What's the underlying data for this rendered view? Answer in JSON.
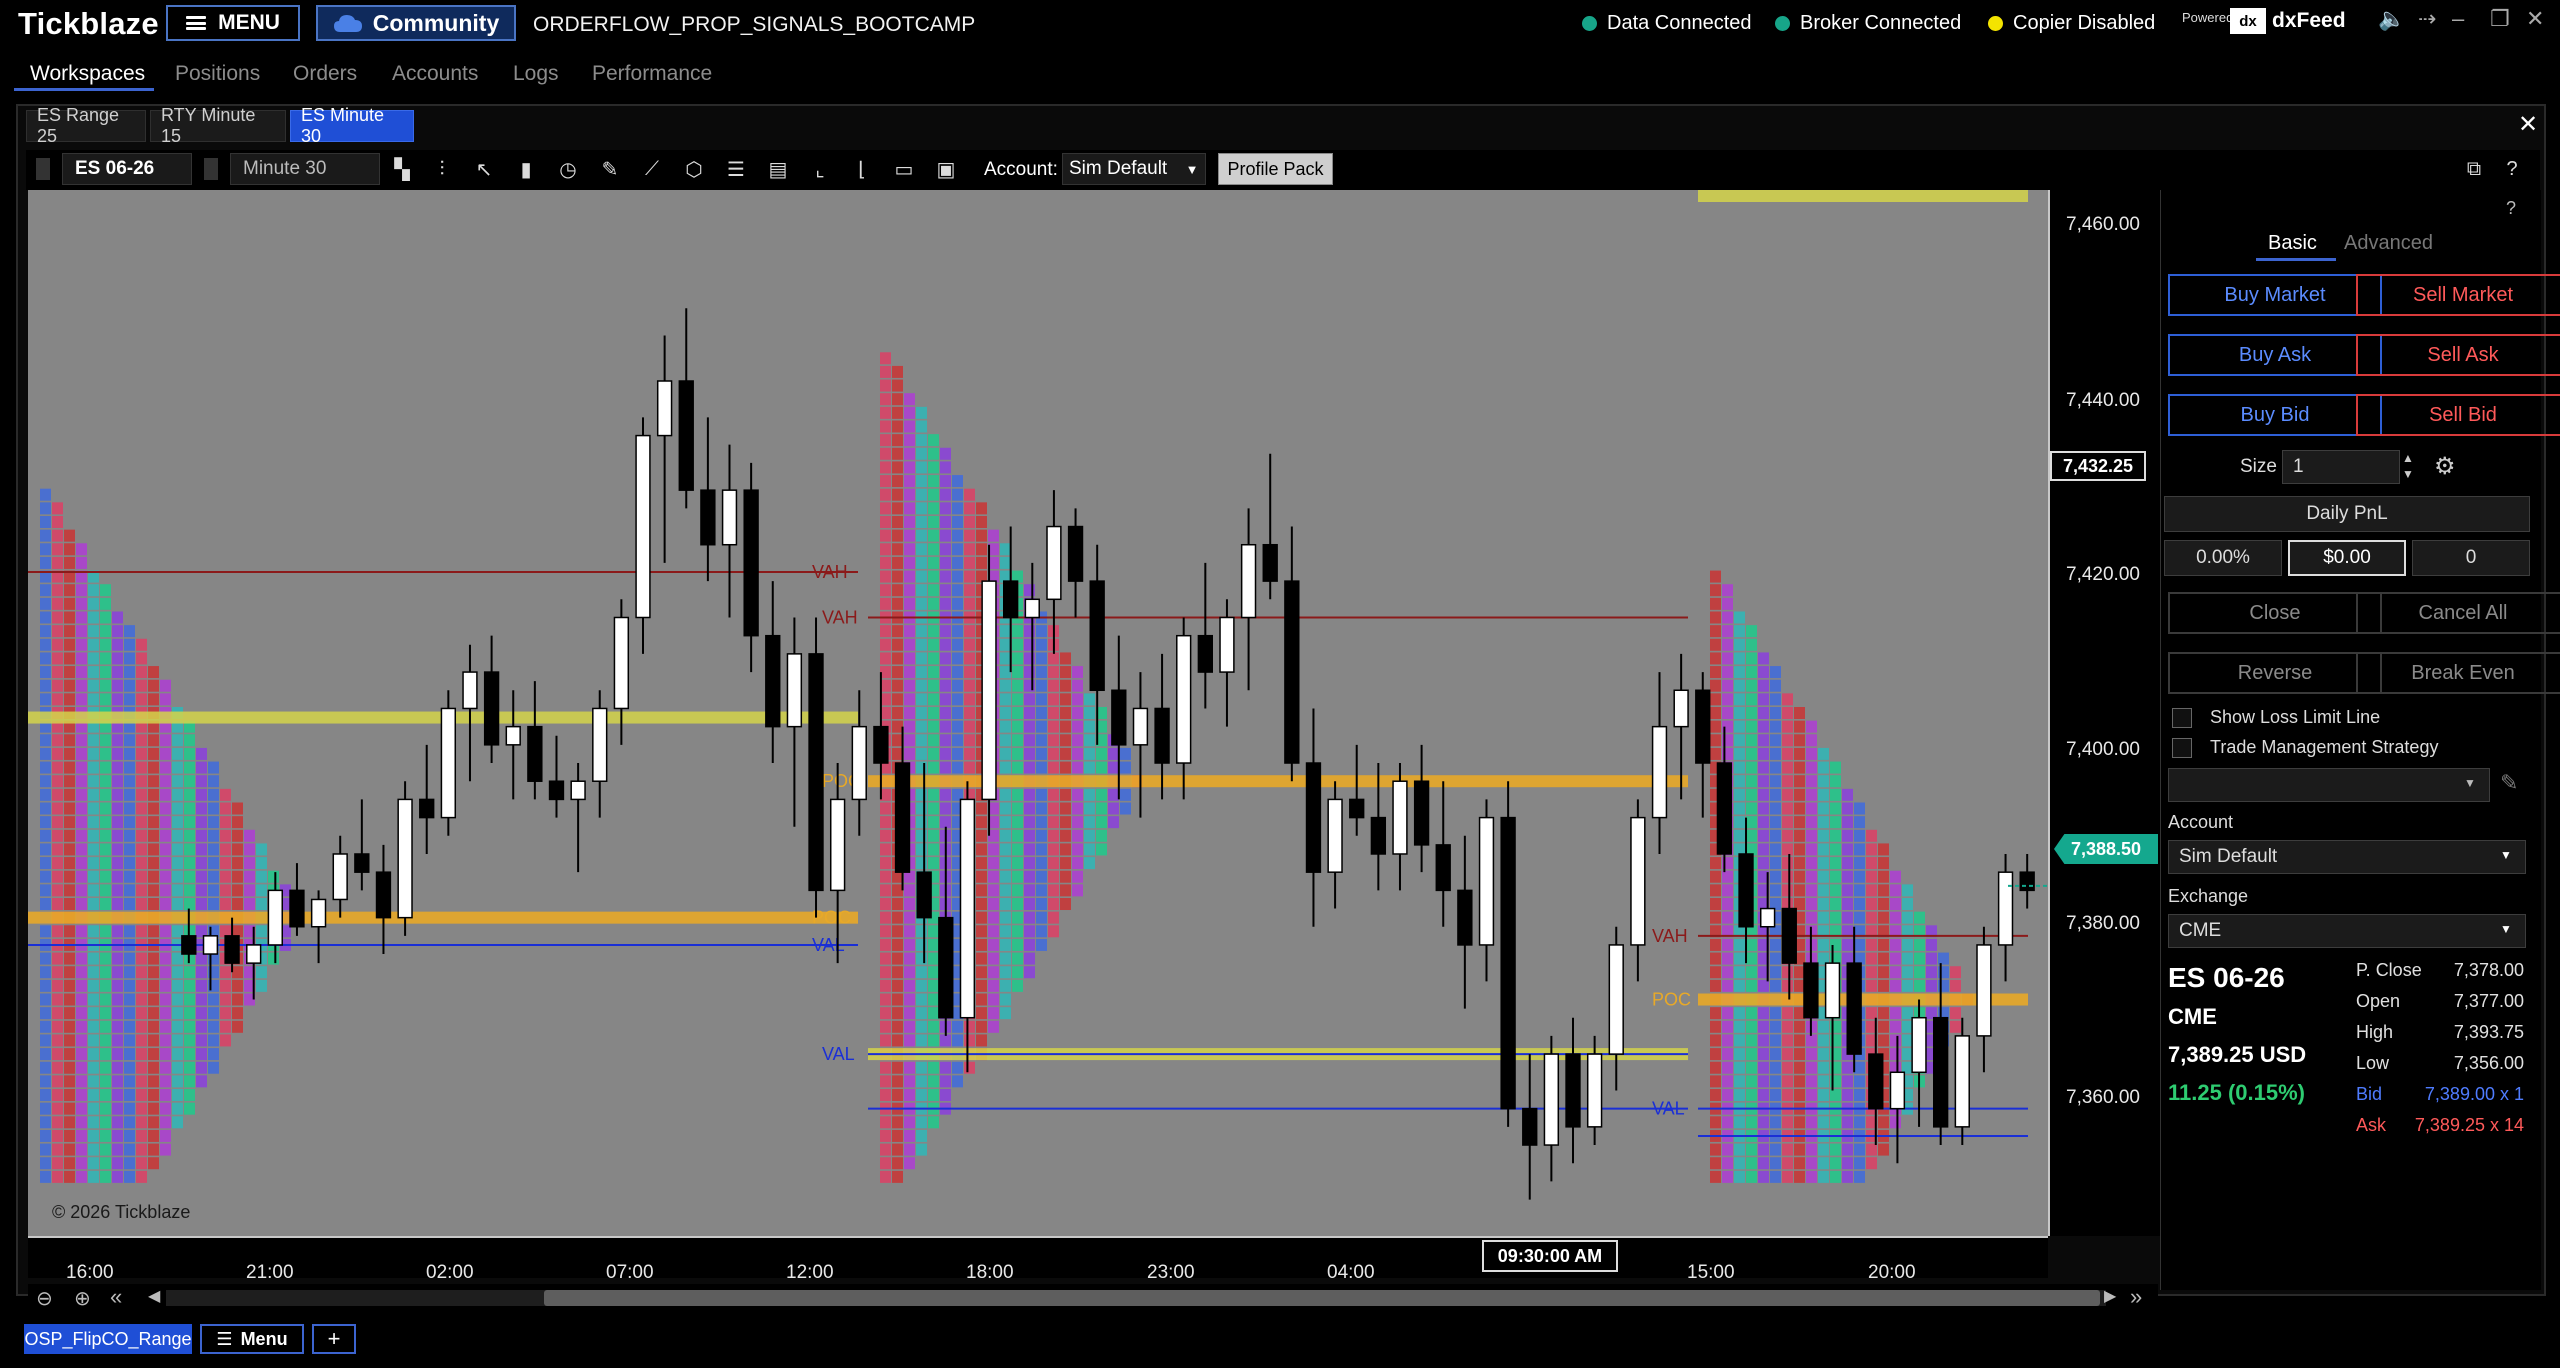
{
  "app": {
    "logo": "Tickblaze",
    "menu_label": "MENU",
    "community_label": "Community",
    "workspace_title": "ORDERFLOW_PROP_SIGNALS_BOOTCAMP",
    "status": [
      {
        "label": "Data Connected",
        "color": "#17a589"
      },
      {
        "label": "Broker Connected",
        "color": "#17a589"
      },
      {
        "label": "Copier Disabled",
        "color": "#f4e400"
      }
    ],
    "powered_by": "Powered by",
    "vendor": "dxFeed"
  },
  "nav": {
    "items": [
      "Workspaces",
      "Positions",
      "Orders",
      "Accounts",
      "Logs",
      "Performance"
    ],
    "active": "Workspaces"
  },
  "tabs": {
    "items": [
      "ES Range 25",
      "RTY Minute 15",
      "ES Minute 30"
    ],
    "active": "ES Minute 30"
  },
  "toolbar": {
    "symbol": "ES 06-26",
    "timeframe": "Minute 30",
    "account_label": "Account:",
    "account_value": "Sim Default",
    "profile_pack_label": "Profile Pack",
    "icons": [
      "bar-type-icon",
      "indicators-icon",
      "cursor-icon",
      "volume-bars-icon",
      "clock-icon",
      "pencil-icon",
      "line-draw-icon",
      "cube-icon",
      "list-icon",
      "template-icon",
      "axis-icon",
      "axis-alt-icon",
      "folder-icon",
      "save-icon"
    ]
  },
  "chart": {
    "copyright": "© 2026 Tickblaze",
    "crosshair_time": "09:30:00 AM",
    "crosshair_price": "7,432.25",
    "last_price": "7,388.50",
    "price_ticks": [
      "7,460.00",
      "7,440.00",
      "7,420.00",
      "7,400.00",
      "7,380.00",
      "7,360.00"
    ],
    "time_ticks": [
      "16:00",
      "21:00",
      "02:00",
      "07:00",
      "12:00",
      "18:00",
      "23:00",
      "04:00",
      "15:00",
      "20:00"
    ],
    "level_labels": {
      "vah": "VAH",
      "poc": "POC",
      "val": "VAL"
    },
    "colors": {
      "background": "#868686",
      "poc_bar": "#e8a928",
      "va_band": "#d4d44a",
      "vah_line": "#8b1a1a",
      "val_line": "#1a2fd6",
      "last_price": "#14a88e"
    }
  },
  "chart_data": {
    "type": "candlestick",
    "title": "",
    "symbol": "ES 06-26",
    "interval": "Minute 30",
    "ylim": [
      7350,
      7465
    ],
    "yticks": [
      7360,
      7380,
      7400,
      7420,
      7440,
      7460
    ],
    "xticks": [
      "16:00",
      "21:00",
      "02:00",
      "07:00",
      "12:00",
      "18:00",
      "23:00",
      "04:00",
      "15:00",
      "20:00"
    ],
    "grid": false,
    "last_price": 7388.5,
    "sessions": [
      {
        "vah": 7423,
        "poc": 7385,
        "val": 7382,
        "va_band": 7407
      },
      {
        "vah": 7418,
        "poc": 7400,
        "val": 7370,
        "val2": 7364,
        "va_band": 7370
      },
      {
        "vah": 7383,
        "poc": 7376,
        "val": 7364,
        "val2": 7361
      }
    ],
    "candles": [
      [
        7383,
        7386,
        7380,
        7381
      ],
      [
        7381,
        7384,
        7377,
        7383
      ],
      [
        7383,
        7385,
        7379,
        7380
      ],
      [
        7380,
        7384,
        7376,
        7382
      ],
      [
        7382,
        7390,
        7380,
        7388
      ],
      [
        7388,
        7391,
        7383,
        7384
      ],
      [
        7384,
        7388,
        7380,
        7387
      ],
      [
        7387,
        7394,
        7385,
        7392
      ],
      [
        7392,
        7398,
        7388,
        7390
      ],
      [
        7390,
        7393,
        7381,
        7385
      ],
      [
        7385,
        7400,
        7383,
        7398
      ],
      [
        7398,
        7404,
        7392,
        7396
      ],
      [
        7396,
        7410,
        7394,
        7408
      ],
      [
        7408,
        7415,
        7400,
        7412
      ],
      [
        7412,
        7416,
        7402,
        7404
      ],
      [
        7404,
        7410,
        7398,
        7406
      ],
      [
        7406,
        7411,
        7398,
        7400
      ],
      [
        7400,
        7405,
        7396,
        7398
      ],
      [
        7398,
        7402,
        7390,
        7400
      ],
      [
        7400,
        7410,
        7396,
        7408
      ],
      [
        7408,
        7420,
        7404,
        7418
      ],
      [
        7418,
        7440,
        7414,
        7438
      ],
      [
        7438,
        7449,
        7424,
        7444
      ],
      [
        7444,
        7452,
        7430,
        7432
      ],
      [
        7432,
        7440,
        7422,
        7426
      ],
      [
        7426,
        7437,
        7418,
        7432
      ],
      [
        7432,
        7435,
        7412,
        7416
      ],
      [
        7416,
        7422,
        7402,
        7406
      ],
      [
        7406,
        7418,
        7395,
        7414
      ],
      [
        7414,
        7418,
        7385,
        7388
      ],
      [
        7388,
        7402,
        7380,
        7398
      ],
      [
        7398,
        7410,
        7394,
        7406
      ],
      [
        7406,
        7412,
        7398,
        7402
      ],
      [
        7402,
        7406,
        7388,
        7390
      ],
      [
        7390,
        7402,
        7380,
        7385
      ],
      [
        7385,
        7395,
        7372,
        7374
      ],
      [
        7374,
        7400,
        7368,
        7398
      ],
      [
        7398,
        7426,
        7394,
        7422
      ],
      [
        7422,
        7428,
        7412,
        7418
      ],
      [
        7418,
        7424,
        7410,
        7420
      ],
      [
        7420,
        7432,
        7414,
        7428
      ],
      [
        7428,
        7430,
        7418,
        7422
      ],
      [
        7422,
        7426,
        7404,
        7410
      ],
      [
        7410,
        7416,
        7398,
        7404
      ],
      [
        7404,
        7412,
        7396,
        7408
      ],
      [
        7408,
        7414,
        7398,
        7402
      ],
      [
        7402,
        7418,
        7398,
        7416
      ],
      [
        7416,
        7424,
        7408,
        7412
      ],
      [
        7412,
        7420,
        7406,
        7418
      ],
      [
        7418,
        7430,
        7410,
        7426
      ],
      [
        7426,
        7436,
        7420,
        7422
      ],
      [
        7422,
        7428,
        7400,
        7402
      ],
      [
        7402,
        7408,
        7384,
        7390
      ],
      [
        7390,
        7400,
        7386,
        7398
      ],
      [
        7398,
        7404,
        7394,
        7396
      ],
      [
        7396,
        7402,
        7388,
        7392
      ],
      [
        7392,
        7402,
        7388,
        7400
      ],
      [
        7400,
        7404,
        7390,
        7393
      ],
      [
        7393,
        7400,
        7384,
        7388
      ],
      [
        7388,
        7394,
        7375,
        7382
      ],
      [
        7382,
        7398,
        7378,
        7396
      ],
      [
        7396,
        7400,
        7362,
        7364
      ],
      [
        7364,
        7370,
        7354,
        7360
      ],
      [
        7360,
        7372,
        7356,
        7370
      ],
      [
        7370,
        7374,
        7358,
        7362
      ],
      [
        7362,
        7372,
        7360,
        7370
      ],
      [
        7370,
        7384,
        7366,
        7382
      ],
      [
        7382,
        7398,
        7378,
        7396
      ],
      [
        7396,
        7412,
        7392,
        7406
      ],
      [
        7406,
        7414,
        7398,
        7410
      ],
      [
        7410,
        7412,
        7396,
        7402
      ],
      [
        7402,
        7406,
        7390,
        7392
      ],
      [
        7392,
        7396,
        7380,
        7384
      ],
      [
        7384,
        7390,
        7378,
        7386
      ],
      [
        7386,
        7392,
        7376,
        7380
      ],
      [
        7380,
        7384,
        7372,
        7374
      ],
      [
        7374,
        7382,
        7366,
        7380
      ],
      [
        7380,
        7384,
        7368,
        7370
      ],
      [
        7370,
        7374,
        7360,
        7364
      ],
      [
        7364,
        7372,
        7358,
        7368
      ],
      [
        7368,
        7376,
        7362,
        7374
      ],
      [
        7374,
        7380,
        7360,
        7362
      ],
      [
        7362,
        7374,
        7360,
        7372
      ],
      [
        7372,
        7384,
        7368,
        7382
      ],
      [
        7382,
        7392,
        7378,
        7390
      ],
      [
        7390,
        7392,
        7386,
        7388
      ]
    ]
  },
  "side": {
    "tabs": [
      "Basic",
      "Advanced"
    ],
    "active_tab": "Basic",
    "buttons": {
      "buy_market": "Buy Market",
      "sell_market": "Sell Market",
      "buy_ask": "Buy Ask",
      "sell_ask": "Sell Ask",
      "buy_bid": "Buy Bid",
      "sell_bid": "Sell Bid",
      "close": "Close",
      "cancel_all": "Cancel All",
      "reverse": "Reverse",
      "break_even": "Break Even"
    },
    "size_label": "Size",
    "size_value": "1",
    "daily_pnl_label": "Daily PnL",
    "pnl_percent": "0.00%",
    "pnl_value": "$0.00",
    "pnl_count": "0",
    "show_loss_limit": "Show Loss Limit Line",
    "trade_mgmt": "Trade Management Strategy",
    "account_label": "Account",
    "account_value": "Sim Default",
    "exchange_label": "Exchange",
    "exchange_value": "CME",
    "symbol": "ES 06-26",
    "exchange": "CME",
    "price_usd": "7,389.25 USD",
    "change": "11.25 (0.15%)",
    "stats": [
      {
        "label": "P. Close",
        "value": "7,378.00"
      },
      {
        "label": "Open",
        "value": "7,377.00"
      },
      {
        "label": "High",
        "value": "7,393.75"
      },
      {
        "label": "Low",
        "value": "7,356.00"
      },
      {
        "label": "Bid",
        "value": "7,389.00 x 1"
      },
      {
        "label": "Ask",
        "value": "7,389.25 x 14"
      }
    ]
  },
  "bottom": {
    "tab": "OSP_FlipCO_Range",
    "menu": "Menu",
    "add": "+"
  }
}
